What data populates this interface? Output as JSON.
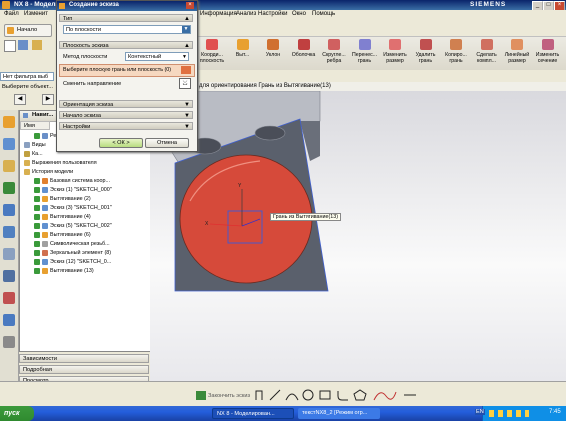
{
  "window": {
    "title": "NX 8 - Моделир...",
    "brand": "SIEMENS"
  },
  "menubar": {
    "items": [
      "Файл",
      "Изменит",
      "Информация",
      "Анализ",
      "Настройки",
      "Окно",
      "Помощь"
    ]
  },
  "quickbar": {
    "start_label": "Начало",
    "filter_value": "Нет фильтра выб"
  },
  "ribbon": {
    "buttons": [
      {
        "label": "Коорди... плоскость",
        "icon": "datum-plane-icon",
        "color": "#e05050"
      },
      {
        "label": "Выт...",
        "icon": "extrude-icon",
        "color": "#e8a030"
      },
      {
        "label": "Уклон",
        "icon": "draft-icon",
        "color": "#d07030"
      },
      {
        "label": "Оболочка",
        "icon": "shell-icon",
        "color": "#c04040"
      },
      {
        "label": "Скругле... ребра",
        "icon": "edge-blend-icon",
        "color": "#d06060"
      },
      {
        "label": "Перенес... грань",
        "icon": "move-face-icon",
        "color": "#8080d0"
      },
      {
        "label": "Изменить размер",
        "icon": "resize-icon",
        "color": "#e07070"
      },
      {
        "label": "Удалить грань",
        "icon": "delete-face-icon",
        "color": "#c05050"
      },
      {
        "label": "Копиро... грань",
        "icon": "copy-face-icon",
        "color": "#d08050"
      },
      {
        "label": "Сделать компл...",
        "icon": "coplanar-icon",
        "color": "#d07060"
      },
      {
        "label": "Линейный размер",
        "icon": "linear-dim-icon",
        "color": "#e09060"
      },
      {
        "label": "Изменить сечение",
        "icon": "cross-section-icon",
        "color": "#c06080"
      }
    ]
  },
  "selection_hint": {
    "prefix": "Выберите объект...",
    "text": "для ориентирования Грань из Вытягивание(13)"
  },
  "dialog": {
    "title": "Создание эскиза",
    "type_section": "Тип",
    "type_value": "По плоскости",
    "plane_section": "Плоскость эскиза",
    "method_label": "Метод плоскости",
    "method_value": "Контекстный",
    "select_face_label": "Выберите плоскую грань или плоскость (0)",
    "reverse_label": "Сменить направление",
    "orientation_section": "Ориентация эскиза",
    "origin_section": "Начало эскиза",
    "settings_section": "Настройки",
    "ok_label": "< ОК >",
    "cancel_label": "Отмена"
  },
  "navigator": {
    "title": "Навиг...",
    "name_header": "Имя",
    "rows": [
      {
        "label": "Режим",
        "indent": 1,
        "color": "#6a8fc8"
      },
      {
        "label": "Виды",
        "indent": 0,
        "color": "#8aa0c0"
      },
      {
        "label": "Ка...",
        "indent": 0,
        "color": "#c0a040"
      },
      {
        "label": "Выражения пользователя",
        "indent": 0,
        "color": "#d8b050"
      },
      {
        "label": "История модели",
        "indent": 0,
        "color": "#d8b050"
      },
      {
        "label": "Базовая система коор...",
        "indent": 1,
        "color": "#e08030"
      },
      {
        "label": "Эскиз (1) \"SKETCH_000\"",
        "indent": 1,
        "color": "#6090d0"
      },
      {
        "label": "Вытягивание (2)",
        "indent": 1,
        "color": "#e8a030"
      },
      {
        "label": "Эскиз (3) \"SKETCH_001\"",
        "indent": 1,
        "color": "#6090d0"
      },
      {
        "label": "Вытягивание (4)",
        "indent": 1,
        "color": "#e8a030"
      },
      {
        "label": "Эскиз (5) \"SKETCH_002\"",
        "indent": 1,
        "color": "#6090d0"
      },
      {
        "label": "Вытягивание (6)",
        "indent": 1,
        "color": "#e8a030"
      },
      {
        "label": "Символическая резьб...",
        "indent": 1,
        "color": "#a0a0a0"
      },
      {
        "label": "Зеркальный элемент (8)",
        "indent": 1,
        "color": "#d07050"
      },
      {
        "label": "Эскиз (12) \"SKETCH_0...",
        "indent": 1,
        "color": "#6090d0"
      },
      {
        "label": "Вытягивание (13)",
        "indent": 1,
        "color": "#e8a030"
      }
    ]
  },
  "bottom_panels": [
    "Зависимости",
    "Подробная",
    "Просмотр"
  ],
  "viewport": {
    "tooltip": "Грань из Вытягивание(13)",
    "face_color": "#d64a3a",
    "body_color": "#5a606c"
  },
  "sketch_toolbar": {
    "finish_label": "Закончить эскиз"
  },
  "taskbar": {
    "start_label": "пуск",
    "tasks": [
      "NX 8 - Моделирован...",
      "текстNX8_2 [Режим огр..."
    ],
    "lang": "EN",
    "clock": "7:45"
  }
}
